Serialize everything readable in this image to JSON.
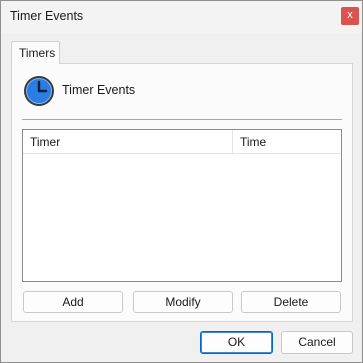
{
  "window": {
    "title": "Timer Events",
    "close_label": "x"
  },
  "tabs": [
    {
      "label": "Timers"
    }
  ],
  "panel": {
    "title": "Timer Events",
    "icon": "clock-icon",
    "list": {
      "columns": [
        "Timer",
        "Time"
      ],
      "rows": []
    },
    "buttons": {
      "add": "Add",
      "modify": "Modify",
      "delete": "Delete"
    }
  },
  "footer": {
    "ok": "OK",
    "cancel": "Cancel"
  },
  "colors": {
    "accent": "#0a64c8",
    "close": "#d9534f",
    "icon_blue": "#2a7de1"
  }
}
